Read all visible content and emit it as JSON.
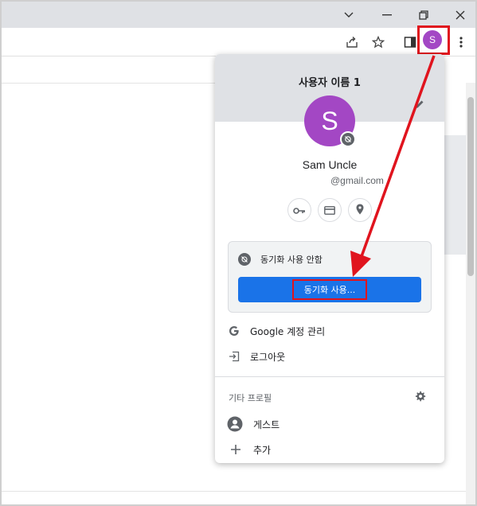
{
  "window": {
    "minimize_icon": "chevron-down-icon",
    "buttons": [
      "minimize-icon",
      "restore-icon",
      "close-icon"
    ]
  },
  "toolbar": {
    "avatar_letter": "S",
    "icons": [
      "share-icon",
      "star-icon",
      "sidepanel-icon",
      "more-icon"
    ]
  },
  "panel": {
    "profile_name": "사용자 이름 1",
    "avatar_letter": "S",
    "account_name": "Sam Uncle",
    "account_email": "@gmail.com",
    "quick_buttons": [
      "key-icon",
      "card-icon",
      "location-icon"
    ],
    "sync_status": "동기화 사용 안함",
    "sync_button": "동기화 사용...",
    "manage_account": "Google 계정 관리",
    "logout": "로그아웃",
    "other_profiles_label": "기타 프로필",
    "guest": "게스트",
    "add": "추가"
  },
  "colors": {
    "avatar": "#a347c4",
    "accent": "#1a73e8",
    "annotation": "#e0141e"
  }
}
